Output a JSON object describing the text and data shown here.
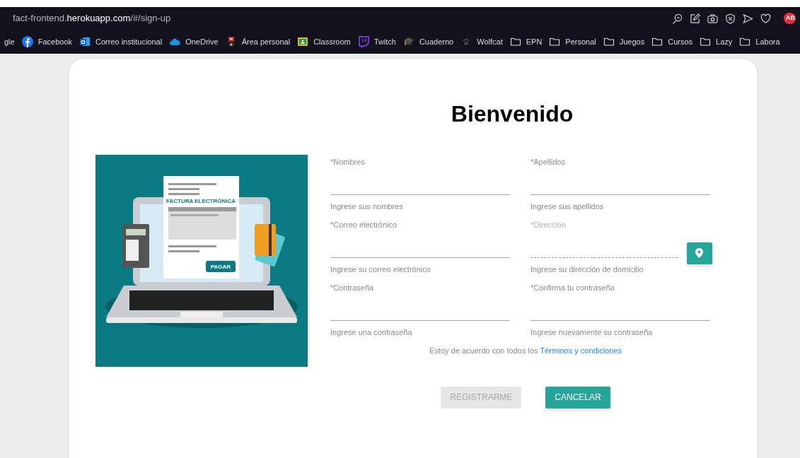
{
  "browser": {
    "url": "fact-frontend.**herokuapp.com**/#/sign-up",
    "extension_badge": "AB",
    "bookmarks": [
      {
        "label": "gle",
        "kind": "plain"
      },
      {
        "label": "Facebook",
        "kind": "facebook"
      },
      {
        "label": "Correo institucional",
        "kind": "mail"
      },
      {
        "label": "OneDrive",
        "kind": "cloud"
      },
      {
        "label": "Área personal",
        "kind": "crest"
      },
      {
        "label": "Classroom",
        "kind": "classroom"
      },
      {
        "label": "Twitch",
        "kind": "chat"
      },
      {
        "label": "Cuaderno",
        "kind": "cap"
      },
      {
        "label": "Wolfcat",
        "kind": "paw"
      },
      {
        "label": "EPN",
        "kind": "folder"
      },
      {
        "label": "Personal",
        "kind": "folder"
      },
      {
        "label": "Juegos",
        "kind": "folder"
      },
      {
        "label": "Cursos",
        "kind": "folder"
      },
      {
        "label": "Lazy",
        "kind": "folder"
      },
      {
        "label": "Labora",
        "kind": "folder"
      }
    ]
  },
  "form": {
    "title": "Bienvenido",
    "illustration": {
      "document_title": "FACTURA ELECTRÓNICA",
      "pay_button": "PAGAR"
    },
    "fields": [
      {
        "label": "*Nombres",
        "helper": "Ingrese sus nombres",
        "kind": "text",
        "disabled": false
      },
      {
        "label": "*Apellidos",
        "helper": "Ingrese sus apellidos",
        "kind": "text",
        "disabled": false
      },
      {
        "label": "*Correo electrónico",
        "helper": "Ingrese su correo electrónico",
        "kind": "text",
        "disabled": false
      },
      {
        "label": "*Dirección",
        "helper": "Ingrese su dirección de domicilio",
        "kind": "location",
        "disabled": true
      },
      {
        "label": "*Contraseña",
        "helper": "Ingrese una contraseña",
        "kind": "text",
        "disabled": false
      },
      {
        "label": "*Confirma tu contraseña",
        "helper": "Ingrese nuevamente su contraseña",
        "kind": "text",
        "disabled": false
      }
    ],
    "terms_text": "Estoy de acuerdo con todos los",
    "terms_link": "Términos y condiciones",
    "buttons": [
      {
        "label": "REGISTRARME",
        "disabled": true
      },
      {
        "label": "CANCELAR",
        "disabled": false
      }
    ]
  }
}
